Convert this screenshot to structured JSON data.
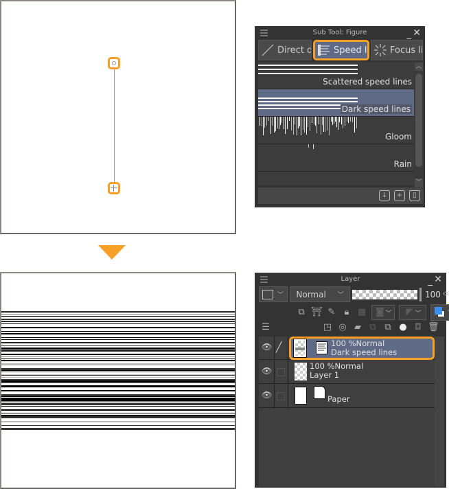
{
  "arrow_color": "#f6a02a",
  "subtool_panel": {
    "title": "Sub Tool: Figure",
    "tabs": [
      {
        "label": "Direct draw",
        "icon": "line-icon",
        "active": false
      },
      {
        "label": "Speed lines",
        "icon": "speed-lines-icon",
        "active": true
      },
      {
        "label": "Focus lines",
        "icon": "focus-lines-icon",
        "active": false
      }
    ],
    "items": [
      {
        "label": "Scattered speed lines",
        "selected": false
      },
      {
        "label": "Dark speed lines",
        "selected": true
      },
      {
        "label": "Gloom",
        "selected": false
      },
      {
        "label": "Rain",
        "selected": false
      }
    ],
    "footer_icons": [
      "register-material-icon",
      "duplicate-subtool-icon",
      "delete-subtool-icon"
    ]
  },
  "layer_panel": {
    "title": "Layer",
    "blend_mode": "Normal",
    "opacity": "100",
    "layers": [
      {
        "opacity_mode": "100 %Normal",
        "name": "Dark speed lines",
        "selected": true,
        "visible": true
      },
      {
        "opacity_mode": "100 %Normal",
        "name": "Layer 1",
        "selected": false,
        "visible": true
      },
      {
        "opacity_mode": "",
        "name": "Paper",
        "selected": false,
        "visible": true
      }
    ]
  },
  "accent_color": "#f6a02a",
  "selection_color": "#5f6a86"
}
